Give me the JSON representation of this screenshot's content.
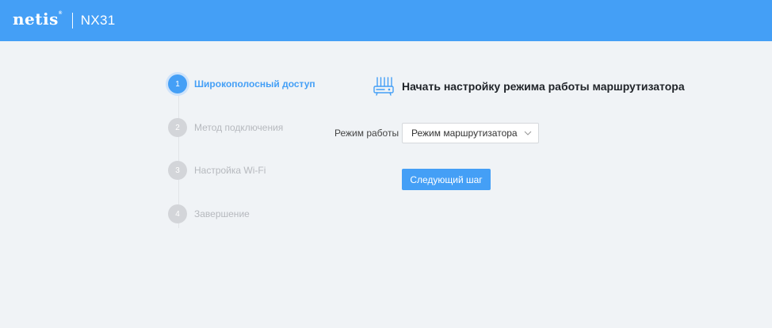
{
  "header": {
    "brand": "netis",
    "brand_mark": "®",
    "model": "NX31",
    "background": "#449ff6"
  },
  "steps": [
    {
      "number": "1",
      "label": "Широкополосный доступ",
      "state": "active"
    },
    {
      "number": "2",
      "label": "Метод подключения",
      "state": "inactive"
    },
    {
      "number": "3",
      "label": "Настройка Wi-Fi",
      "state": "inactive"
    },
    {
      "number": "4",
      "label": "Завершение",
      "state": "inactive"
    }
  ],
  "main": {
    "icon": "router-icon",
    "title": "Начать настройку режима работы маршрутизатора",
    "mode_label": "Режим работы",
    "mode_value": "Режим маршрутизатора",
    "next_button": "Следующий шаг"
  },
  "colors": {
    "accent": "#449ff6",
    "inactive_step": "#d3d5d9",
    "page_bg": "#f0f3f6"
  }
}
